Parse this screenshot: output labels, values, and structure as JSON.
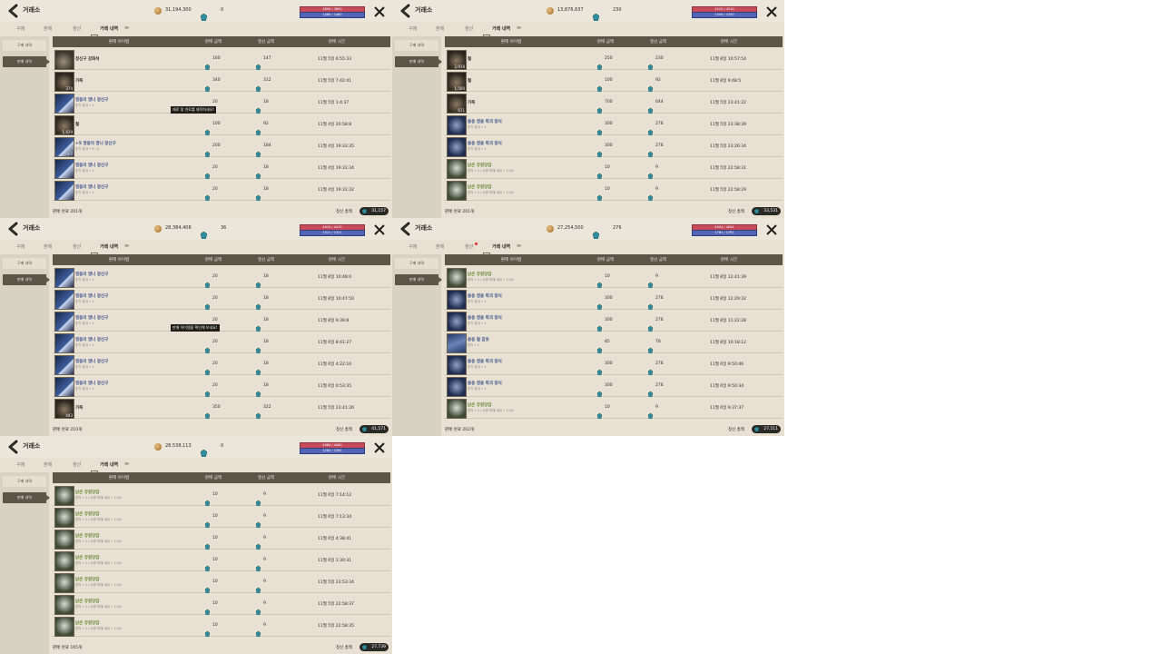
{
  "colors": {
    "panel_bg": "#e7e0d3",
    "header_bg": "#5c5548",
    "hp_bar": "#c94b5b",
    "mp_bar": "#5565b5",
    "gem": "#2e8c9c",
    "green_item": "#6b8a3a",
    "blue_item": "#3b4f8c"
  },
  "icons": {
    "back": "chevron-left-icon",
    "close": "close-icon",
    "gold": "gold-coin-icon",
    "gem": "blue-gem-icon",
    "tab_history": "scroll-icon"
  },
  "common": {
    "title": "거래소",
    "tabs": [
      "구매",
      "판매",
      "정산",
      "거래 내역"
    ],
    "sidebar": [
      "구매 내역",
      "판매 내역"
    ],
    "columns": [
      "판매 아이템",
      "판매 금액",
      "정산 금액",
      "판매 시간"
    ],
    "footer_label": "정산 총액"
  },
  "panels": [
    {
      "gold": "31,194,300",
      "gems": "0",
      "hp": "3890 / 3890",
      "mp": "1480 / 1480",
      "tab_dot": false,
      "tooltip": "재료 및 연료를 제작하세요!",
      "tooltip_row": 2,
      "rows": [
        {
          "thumb": "grey-dust",
          "qty": "",
          "name": "정신구 강화석",
          "name_class": "",
          "sub": "",
          "price": "160",
          "settle": "147",
          "time": "11월 5일 6:55:33"
        },
        {
          "thumb": "brown-ore",
          "qty": "374",
          "name": "가죽",
          "name_class": "",
          "sub": "",
          "price": "340",
          "settle": "312",
          "time": "11월 5일 7:42:41"
        },
        {
          "thumb": "blue-feather",
          "qty": "",
          "name": "영웅의 영니 장신구",
          "name_class": "blue",
          "sub": "추가 효과 • 1",
          "price": "20",
          "settle": "18",
          "time": "11월 5일 1:4:37"
        },
        {
          "thumb": "brown-ore",
          "qty": "1,429",
          "name": "철",
          "name_class": "",
          "sub": "",
          "price": "100",
          "settle": "92",
          "time": "11월 4일 20:58:8"
        },
        {
          "thumb": "blue-feather",
          "qty": "+5",
          "name": "+5 영웅의 영니 장신구",
          "name_class": "blue",
          "sub": "추가 효과 • 6 / 5",
          "price": "200",
          "settle": "184",
          "time": "11월 4일 19:33:35"
        },
        {
          "thumb": "blue-feather",
          "qty": "",
          "name": "영웅의 영니 장신구",
          "name_class": "blue",
          "sub": "추가 효과 • 1",
          "price": "20",
          "settle": "18",
          "time": "11월 4일 19:31:34"
        },
        {
          "thumb": "blue-feather",
          "qty": "",
          "name": "영웅의 영니 장신구",
          "name_class": "blue",
          "sub": "추가 효과 • 1",
          "price": "20",
          "settle": "18",
          "time": "11월 4일 19:31:32"
        }
      ],
      "footer_count": "판매 완료 201개",
      "total": "31,157"
    },
    {
      "gold": "13,676,637",
      "gems": "230",
      "hp": "4210 / 4210",
      "mp": "1340 / 1340",
      "tab_dot": false,
      "tooltip": "",
      "tooltip_row": -1,
      "rows": [
        {
          "thumb": "brown-ore",
          "qty": "2,918",
          "name": "철",
          "name_class": "",
          "sub": "",
          "price": "250",
          "settle": "230",
          "time": "11월 8일 10:57:54"
        },
        {
          "thumb": "brown-ore",
          "qty": "1,500",
          "name": "철",
          "name_class": "",
          "sub": "",
          "price": "100",
          "settle": "92",
          "time": "11월 8일 9:48:5"
        },
        {
          "thumb": "brown-ore",
          "qty": "611",
          "name": "가죽",
          "name_class": "",
          "sub": "",
          "price": "700",
          "settle": "644",
          "time": "11월 5일 23:41:22"
        },
        {
          "thumb": "blue-gear",
          "qty": "",
          "name": "용옹 영웅 파괴 장식",
          "name_class": "blue",
          "sub": "추가 효과 • 1",
          "price": "300",
          "settle": "276",
          "time": "11월 5일 23:38:39"
        },
        {
          "thumb": "blue-gear",
          "qty": "",
          "name": "용옹 영웅 파괴 장식",
          "name_class": "blue",
          "sub": "추가 효과 • 1",
          "price": "300",
          "settle": "276",
          "time": "11월 5일 23:26:34"
        },
        {
          "thumb": "green-ghost",
          "qty": "",
          "name": "낡은 유령장갑",
          "name_class": "green",
          "sub": "방어 • 2 / 소켓 피해 내성 • 1.4%",
          "price": "10",
          "settle": "9",
          "time": "11월 5일 22:58:31"
        },
        {
          "thumb": "green-ghost",
          "qty": "",
          "name": "낡은 유령장갑",
          "name_class": "green",
          "sub": "방어 • 2 / 소켓 피해 내성 • 1.4%",
          "price": "10",
          "settle": "9",
          "time": "11월 5일 22:58:29"
        }
      ],
      "footer_count": "판매 완료 201개",
      "total": "33,531"
    },
    {
      "gold": "28,384,408",
      "gems": "36",
      "hp": "4415 / 4415",
      "mp": "1321 / 1321",
      "tab_dot": false,
      "tooltip": "판매 아이템을 확인해 보세요!",
      "tooltip_row": 2,
      "rows": [
        {
          "thumb": "blue-feather",
          "qty": "",
          "name": "영웅의 영니 장신구",
          "name_class": "blue",
          "sub": "추가 효과 • 1",
          "price": "20",
          "settle": "18",
          "time": "11월 8일 10:48:0"
        },
        {
          "thumb": "blue-feather",
          "qty": "",
          "name": "영웅의 영니 장신구",
          "name_class": "blue",
          "sub": "추가 효과 • 1",
          "price": "20",
          "settle": "18",
          "time": "11월 8일 10:47:50"
        },
        {
          "thumb": "blue-feather",
          "qty": "",
          "name": "영웅의 영니 장신구",
          "name_class": "blue",
          "sub": "추가 효과 • 1",
          "price": "20",
          "settle": "18",
          "time": "11월 8일 9:39:8"
        },
        {
          "thumb": "blue-feather",
          "qty": "",
          "name": "영웅의 영니 장신구",
          "name_class": "blue",
          "sub": "추가 효과 • 1",
          "price": "20",
          "settle": "18",
          "time": "11월 6일 8:41:27"
        },
        {
          "thumb": "blue-feather",
          "qty": "",
          "name": "영웅의 영니 장신구",
          "name_class": "blue",
          "sub": "추가 효과 • 1",
          "price": "20",
          "settle": "18",
          "time": "11월 6일 4:22:10"
        },
        {
          "thumb": "blue-feather",
          "qty": "",
          "name": "영웅의 영니 장신구",
          "name_class": "blue",
          "sub": "추가 효과 • 1",
          "price": "20",
          "settle": "18",
          "time": "11월 6일 0:53:35"
        },
        {
          "thumb": "brown-ore",
          "qty": "443",
          "name": "가죽",
          "name_class": "",
          "sub": "",
          "price": "350",
          "settle": "322",
          "time": "11월 5일 23:41:26"
        }
      ],
      "footer_count": "판매 완료 210개",
      "total": "41,571"
    },
    {
      "gold": "27,254,500",
      "gems": "276",
      "hp": "4004 / 4004",
      "mp": "1781 / 1781",
      "tab_dot": true,
      "tooltip": "",
      "tooltip_row": -1,
      "rows": [
        {
          "thumb": "green-ghost",
          "qty": "",
          "name": "낡은 유령장갑",
          "name_class": "green",
          "sub": "방어 • 2 / 소켓 피해 내성 • 1.4%",
          "price": "10",
          "settle": "9",
          "time": "11월 8일 12:41:39"
        },
        {
          "thumb": "blue-gear",
          "qty": "",
          "name": "용옹 영웅 파괴 장식",
          "name_class": "blue",
          "sub": "추가 효과 • 1",
          "price": "300",
          "settle": "276",
          "time": "11월 8일 12:29:32"
        },
        {
          "thumb": "blue-gear",
          "qty": "",
          "name": "용옹 영웅 파괴 장식",
          "name_class": "blue",
          "sub": "추가 효과 • 1",
          "price": "300",
          "settle": "276",
          "time": "11월 8일 11:22:28"
        },
        {
          "thumb": "blue-armor",
          "qty": "",
          "name": "용옹 철 갑옷",
          "name_class": "blue",
          "sub": "방어 • 1",
          "price": "85",
          "settle": "78",
          "time": "11월 8일 10:18:12"
        },
        {
          "thumb": "blue-gear",
          "qty": "",
          "name": "용옹 영웅 파괴 장식",
          "name_class": "blue",
          "sub": "추가 효과 • 1",
          "price": "300",
          "settle": "276",
          "time": "11월 6일 9:50:46"
        },
        {
          "thumb": "blue-gear",
          "qty": "",
          "name": "용옹 영웅 파괴 장식",
          "name_class": "blue",
          "sub": "추가 효과 • 1",
          "price": "300",
          "settle": "276",
          "time": "11월 6일 9:50:34"
        },
        {
          "thumb": "green-ghost",
          "qty": "",
          "name": "낡은 유령장갑",
          "name_class": "green",
          "sub": "방어 • 2 / 소켓 피해 내성 • 1.4%",
          "price": "10",
          "settle": "9",
          "time": "11월 6일 9:37:37"
        }
      ],
      "footer_count": "판매 완료 202개",
      "total": "27,511"
    },
    {
      "gold": "28,538,113",
      "gems": "0",
      "hp": "4080 / 4080",
      "mp": "1282 / 1282",
      "tab_dot": false,
      "tooltip": "",
      "tooltip_row": -1,
      "rows": [
        {
          "thumb": "green-ghost",
          "qty": "",
          "name": "낡은 유령장갑",
          "name_class": "green",
          "sub": "방어 • 2 / 소켓 피해 내성 • 1.4%",
          "price": "10",
          "settle": "9",
          "time": "11월 6일 7:14:12"
        },
        {
          "thumb": "green-ghost",
          "qty": "",
          "name": "낡은 유령장갑",
          "name_class": "green",
          "sub": "방어 • 2 / 소켓 피해 내성 • 1.4%",
          "price": "10",
          "settle": "9",
          "time": "11월 6일 7:13:34"
        },
        {
          "thumb": "green-ghost",
          "qty": "",
          "name": "낡은 유령장갑",
          "name_class": "green",
          "sub": "방어 • 2 / 소켓 피해 내성 • 1.4%",
          "price": "10",
          "settle": "9",
          "time": "11월 6일 4:38:41"
        },
        {
          "thumb": "green-ghost",
          "qty": "",
          "name": "낡은 유령장갑",
          "name_class": "green",
          "sub": "방어 • 2 / 소켓 피해 내성 • 1.4%",
          "price": "10",
          "settle": "9",
          "time": "11월 6일 1:30:31"
        },
        {
          "thumb": "green-ghost",
          "qty": "",
          "name": "낡은 유령장갑",
          "name_class": "green",
          "sub": "방어 • 2 / 소켓 피해 내성 • 1.4%",
          "price": "10",
          "settle": "9",
          "time": "11월 5일 23:53:34"
        },
        {
          "thumb": "green-ghost",
          "qty": "",
          "name": "낡은 유령장갑",
          "name_class": "green",
          "sub": "방어 • 2 / 소켓 피해 내성 • 1.4%",
          "price": "10",
          "settle": "9",
          "time": "11월 5일 22:58:37"
        },
        {
          "thumb": "green-ghost",
          "qty": "",
          "name": "낡은 유령장갑",
          "name_class": "green",
          "sub": "방어 • 2 / 소켓 피해 내성 • 1.4%",
          "price": "10",
          "settle": "9",
          "time": "11월 5일 22:58:35"
        }
      ],
      "footer_count": "판매 완료 165개",
      "total": "27,739"
    }
  ]
}
